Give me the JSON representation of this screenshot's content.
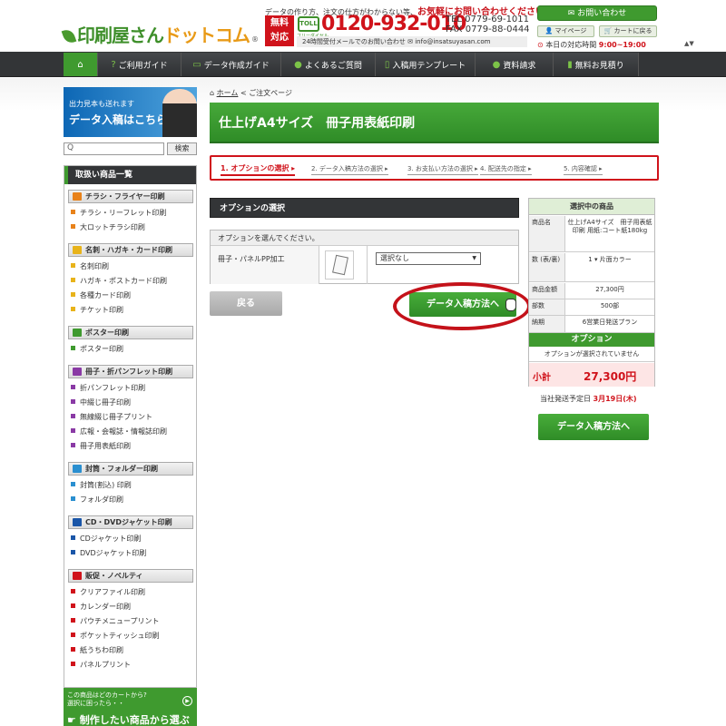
{
  "header": {
    "logo_main": "印刷屋さん",
    "logo_accent": "ドットコム",
    "logo_reg": "®",
    "tagline_pre": "データの作り方、注文の仕方がわからない等、",
    "tagline_strong": "お気軽にお問い合わせください!",
    "free_badge": "無料 対応",
    "freedial_mark": "TOLL",
    "freedial_label": "フリーダイヤル",
    "tel_main": "0120-932-010",
    "tel_line": "TEL 0779-69-1011",
    "fax_line": "FAX 0779-88-0444",
    "hours_note": "24時間受付メールでのお問い合わせ ✉ info@insatsuyasan.com",
    "contact_button": "✉ お問い合わせ",
    "mypage_button": "マイページ",
    "cart_button": "カートに戻る",
    "today_label": "本日の対応時間",
    "today_hours": "9:00~19:00",
    "scroll_arrows": "▲▼"
  },
  "nav": {
    "home_icon": "⌂",
    "items": [
      {
        "icon": "?",
        "label": "ご利用ガイド"
      },
      {
        "icon": "▭",
        "label": "データ作成ガイド"
      },
      {
        "icon": "●",
        "label": "よくあるご質問"
      },
      {
        "icon": "▯",
        "label": "入稿用テンプレート"
      },
      {
        "icon": "●",
        "label": "資料請求"
      },
      {
        "icon": "▮",
        "label": "無料お見積り"
      }
    ]
  },
  "sidebar": {
    "banner_line1": "出力見本も送れます",
    "banner_line2": "データ入稿はこちら",
    "search_placeholder": "Q",
    "search_button": "検索",
    "list_title": "取扱い商品一覧",
    "categories": [
      {
        "label": "チラシ・フライヤー印刷",
        "color": "#e8821a",
        "items": [
          "チラシ・リーフレット印刷",
          "大ロットチラシ印刷"
        ]
      },
      {
        "label": "名刺・ハガキ・カード印刷",
        "color": "#e8b31a",
        "items": [
          "名刺印刷",
          "ハガキ・ポストカード印刷",
          "各種カード印刷",
          "チケット印刷"
        ]
      },
      {
        "label": "ポスター印刷",
        "color": "#3f9a2f",
        "items": [
          "ポスター印刷"
        ]
      },
      {
        "label": "冊子・折パンフレット印刷",
        "color": "#8a3aa5",
        "items": [
          "折パンフレット印刷",
          "中綴じ冊子印刷",
          "無線綴じ冊子プリント",
          "広報・会報誌・情報誌印刷",
          "冊子用表紙印刷"
        ]
      },
      {
        "label": "封筒・フォルダー印刷",
        "color": "#2a8fd0",
        "items": [
          "封筒(割込) 印刷",
          "フォルダ印刷"
        ]
      },
      {
        "label": "CD・DVDジャケット印刷",
        "color": "#1a56a8",
        "items": [
          "CDジャケット印刷",
          "DVDジャケット印刷"
        ]
      },
      {
        "label": "販促・ノベルティ",
        "color": "#d0131b",
        "items": [
          "クリアファイル印刷",
          "カレンダー印刷",
          "パウチメニュープリント",
          "ポケットティッシュ印刷",
          "紙うちわ印刷",
          "パネルプリント"
        ]
      }
    ],
    "bottom_line1": "この商品はどのカートから?",
    "bottom_line2": "選択に困ったら・・",
    "bottom_cta": "制作したい商品から選ぶ",
    "bottom_play": "▶"
  },
  "main": {
    "crumb_home": "ホーム",
    "crumb_sep": "<",
    "crumb_current": "ご注文ページ",
    "title": "仕上げA4サイズ　冊子用表紙印刷",
    "steps": [
      "1. オプションの選択 ▸",
      "2. データ入稿方法の選択 ▸",
      "3. お支払い方法の選択 ▸",
      "4. 配送先の指定 ▸",
      "5. 内容確認 ▸"
    ],
    "option_heading": "オプションの選択",
    "option_note": "オプションを選んでください。",
    "option_label": "冊子・パネルPP加工",
    "option_select_value": "選択なし",
    "back_button": "戻る",
    "next_button": "データ入稿方法へ"
  },
  "summary": {
    "heading": "選択中の商品",
    "rows": [
      {
        "k": "商品名",
        "v": "仕上げA4サイズ　冊子用表紙印刷 用紙:コート紙180kg"
      },
      {
        "k": "数 (表/裏)",
        "v": "1 ▾ 片面カラー"
      },
      {
        "k": "商品金額",
        "v": "27,300円"
      },
      {
        "k": "部数",
        "v": "500部"
      },
      {
        "k": "納期",
        "v": "6営業日発送プラン"
      }
    ],
    "option_heading": "オプション",
    "option_none": "オプションが選択されていません",
    "total_label": "小計",
    "total_value": "27,300円",
    "ship_label": "当社発送予定日",
    "ship_date": "3月19日(木)",
    "next_button": "データ入稿方法へ"
  }
}
